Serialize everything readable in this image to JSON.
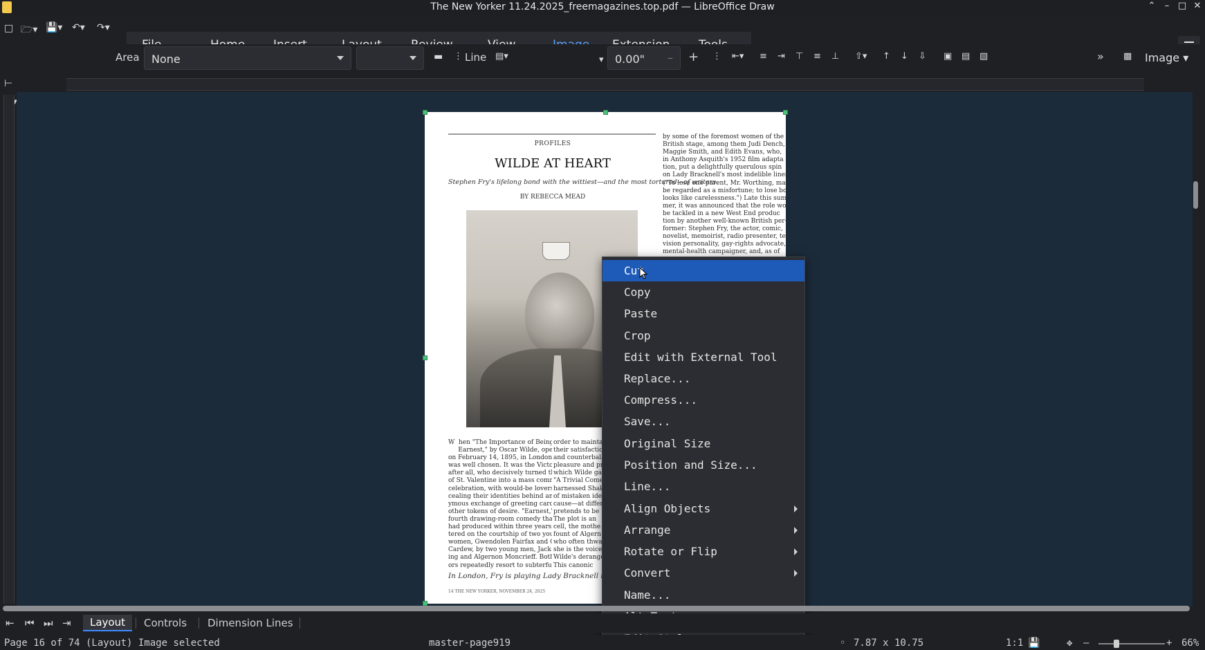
{
  "window": {
    "title": "The New Yorker 11.24.2025_freemagazines.top.pdf — LibreOffice Draw"
  },
  "menubar": {
    "items": [
      {
        "label": "File",
        "active": false
      },
      {
        "label": "Home",
        "active": false
      },
      {
        "label": "Insert",
        "active": false
      },
      {
        "label": "Layout",
        "active": false
      },
      {
        "label": "Review",
        "active": false
      },
      {
        "label": "View",
        "active": false
      },
      {
        "label": "Image",
        "active": true
      },
      {
        "label": "Extension",
        "active": false
      },
      {
        "label": "Tools",
        "active": false
      }
    ]
  },
  "toolbar": {
    "area_label": "Area",
    "area_value": "None",
    "area_color_value": "",
    "line_label": "Line",
    "line_width_value": "0.00\"",
    "context_label": "Image"
  },
  "document": {
    "section": "PROFILES",
    "headline": "WILDE AT HEART",
    "deck": "Stephen Fry's lifelong bond with the wittiest—and the most tortured—of writers.",
    "byline": "BY REBECCA MEAD",
    "col_right_top": "by some of the foremost women of the\nBritish stage, among them Judi Dench,\nMaggie Smith, and Edith Evans, who,\nin Anthony Asquith's 1952 film adapta\ntion, put a delightfully querulous spin\non Lady Bracknell's most indelible lines.\n(\"To lose one parent, Mr. Worthing, may\nbe regarded as a misfortune; to lose bot\nlooks like carelessness.\") Late this sum\nmer, it was announced that the role wou\nbe tackled in a new West End produc\ntion by another well-known British per-\nformer: Stephen Fry, the actor, comic,\nnovelist, memoirist, radio presenter, tel\nvision personality, gay-rights advocate,\nmental-health campaigner, and, as of",
    "col_left_body": "W  hen \"The Importance of Being\n     Earnest,\" by Oscar Wilde, opened\non February 14, 1895, in London, the date\nwas well chosen. It was the Victorians,\nafter all, who decisively turned the feast\nof St. Valentine into a mass commercial\ncelebration, with would-be lovers con\ncealing their identities behind an anon\nymous exchange of greeting cards and\nother tokens of desire. \"Earnest,\" the\nfourth drawing-room comedy that Wilde\nhad produced within three years, cen\ntered on the courtship of two young\nwomen, Gwendolen Fairfax and Cecily\nCardew, by two young men, Jack Worth\ning and Algernon Moncrieff. Both suit\nors repeatedly resort to subterfuge in",
    "col_mid_body": "order to mainta\ntheir satisfaction\nand counterbala\npleasure and pr\nwhich Wilde ga\n\"A Trivial Come\nharnessed Shak\nof mistaken ide\ncause—at differ\npretends to be\nThe plot is an\ncell, the mothe\nfount of Algern\nwho often thwa\nshe is the voice\nWilde's derange\nThis canonic",
    "pull_quote": "In London, Fry is playing Lady Bracknell in \"The Importance of Being Earnest.\"",
    "folio": "14     THE NEW YORKER, NOVEMBER 24, 2025"
  },
  "context_menu": {
    "items": [
      {
        "label": "Cut",
        "selected": true,
        "submenu": false
      },
      {
        "label": "Copy",
        "selected": false,
        "submenu": false
      },
      {
        "label": "Paste",
        "selected": false,
        "submenu": false
      },
      {
        "label": "Crop",
        "selected": false,
        "submenu": false
      },
      {
        "label": "Edit with External Tool",
        "selected": false,
        "submenu": false
      },
      {
        "label": "Replace...",
        "selected": false,
        "submenu": false
      },
      {
        "label": "Compress...",
        "selected": false,
        "submenu": false
      },
      {
        "label": "Save...",
        "selected": false,
        "submenu": false
      },
      {
        "label": "Original Size",
        "selected": false,
        "submenu": false
      },
      {
        "label": "Position and Size...",
        "selected": false,
        "submenu": false
      },
      {
        "label": "Line...",
        "selected": false,
        "submenu": false
      },
      {
        "label": "Align Objects",
        "selected": false,
        "submenu": true
      },
      {
        "label": "Arrange",
        "selected": false,
        "submenu": true
      },
      {
        "label": "Rotate or Flip",
        "selected": false,
        "submenu": true
      },
      {
        "label": "Convert",
        "selected": false,
        "submenu": true
      },
      {
        "label": "Name...",
        "selected": false,
        "submenu": false
      },
      {
        "label": "Alt Text...",
        "selected": false,
        "submenu": false
      },
      {
        "label": "Edit Style...",
        "selected": false,
        "submenu": false
      }
    ]
  },
  "bottom_tabs": [
    {
      "label": "Layout",
      "active": true
    },
    {
      "label": "Controls",
      "active": false
    },
    {
      "label": "Dimension Lines",
      "active": false
    }
  ],
  "statusbar": {
    "page_info": "Page 16 of 74 (Layout)  Image selected",
    "master_page": "master-page919",
    "dimensions": "7.87 x 10.75",
    "scale": "1:1",
    "zoom": "66%"
  },
  "colors": {
    "accent": "#3e8bff",
    "menu_selection": "#1e5ab8",
    "handle": "#4cc27a",
    "canvas": "#1c2b3a"
  }
}
